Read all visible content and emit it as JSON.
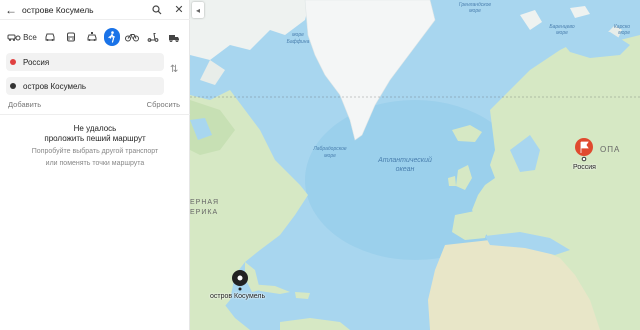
{
  "search": {
    "text": "острове Косумель"
  },
  "modes": {
    "all_label": "Все"
  },
  "route": {
    "from": "Россия",
    "to": "остров Косумель",
    "add_label": "Добавить",
    "reset_label": "Сбросить"
  },
  "message": {
    "title_line1": "Не удалось",
    "title_line2": "проложить пеший маршрут",
    "hint_line1": "Попробуйте выбрать другой транспорт",
    "hint_line2": "или поменять точки маршрута"
  },
  "map": {
    "labels": {
      "atlantic1": "Атлантический",
      "atlantic2": "океан",
      "baffin1": "море",
      "baffin2": "Баффина",
      "greenland_sea1": "Гренландское",
      "greenland_sea2": "море",
      "barents1": "Баренцево",
      "barents2": "море",
      "kara1": "Карско",
      "kara2": "море",
      "labrador1": "Лабрадорское",
      "labrador2": "море",
      "europe_partial": "ОПА",
      "namerica_partial1": "ЕРНАЯ",
      "namerica_partial2": "ЕРИКА"
    },
    "markers": {
      "destination": "остров Косумель",
      "origin": "Россия"
    },
    "colors": {
      "ocean": "#a8d6ef",
      "deep_ocean": "#86c3e6",
      "land": "#d6e8c4",
      "ice": "#f4f6f6",
      "route_start": "#e04040"
    }
  }
}
